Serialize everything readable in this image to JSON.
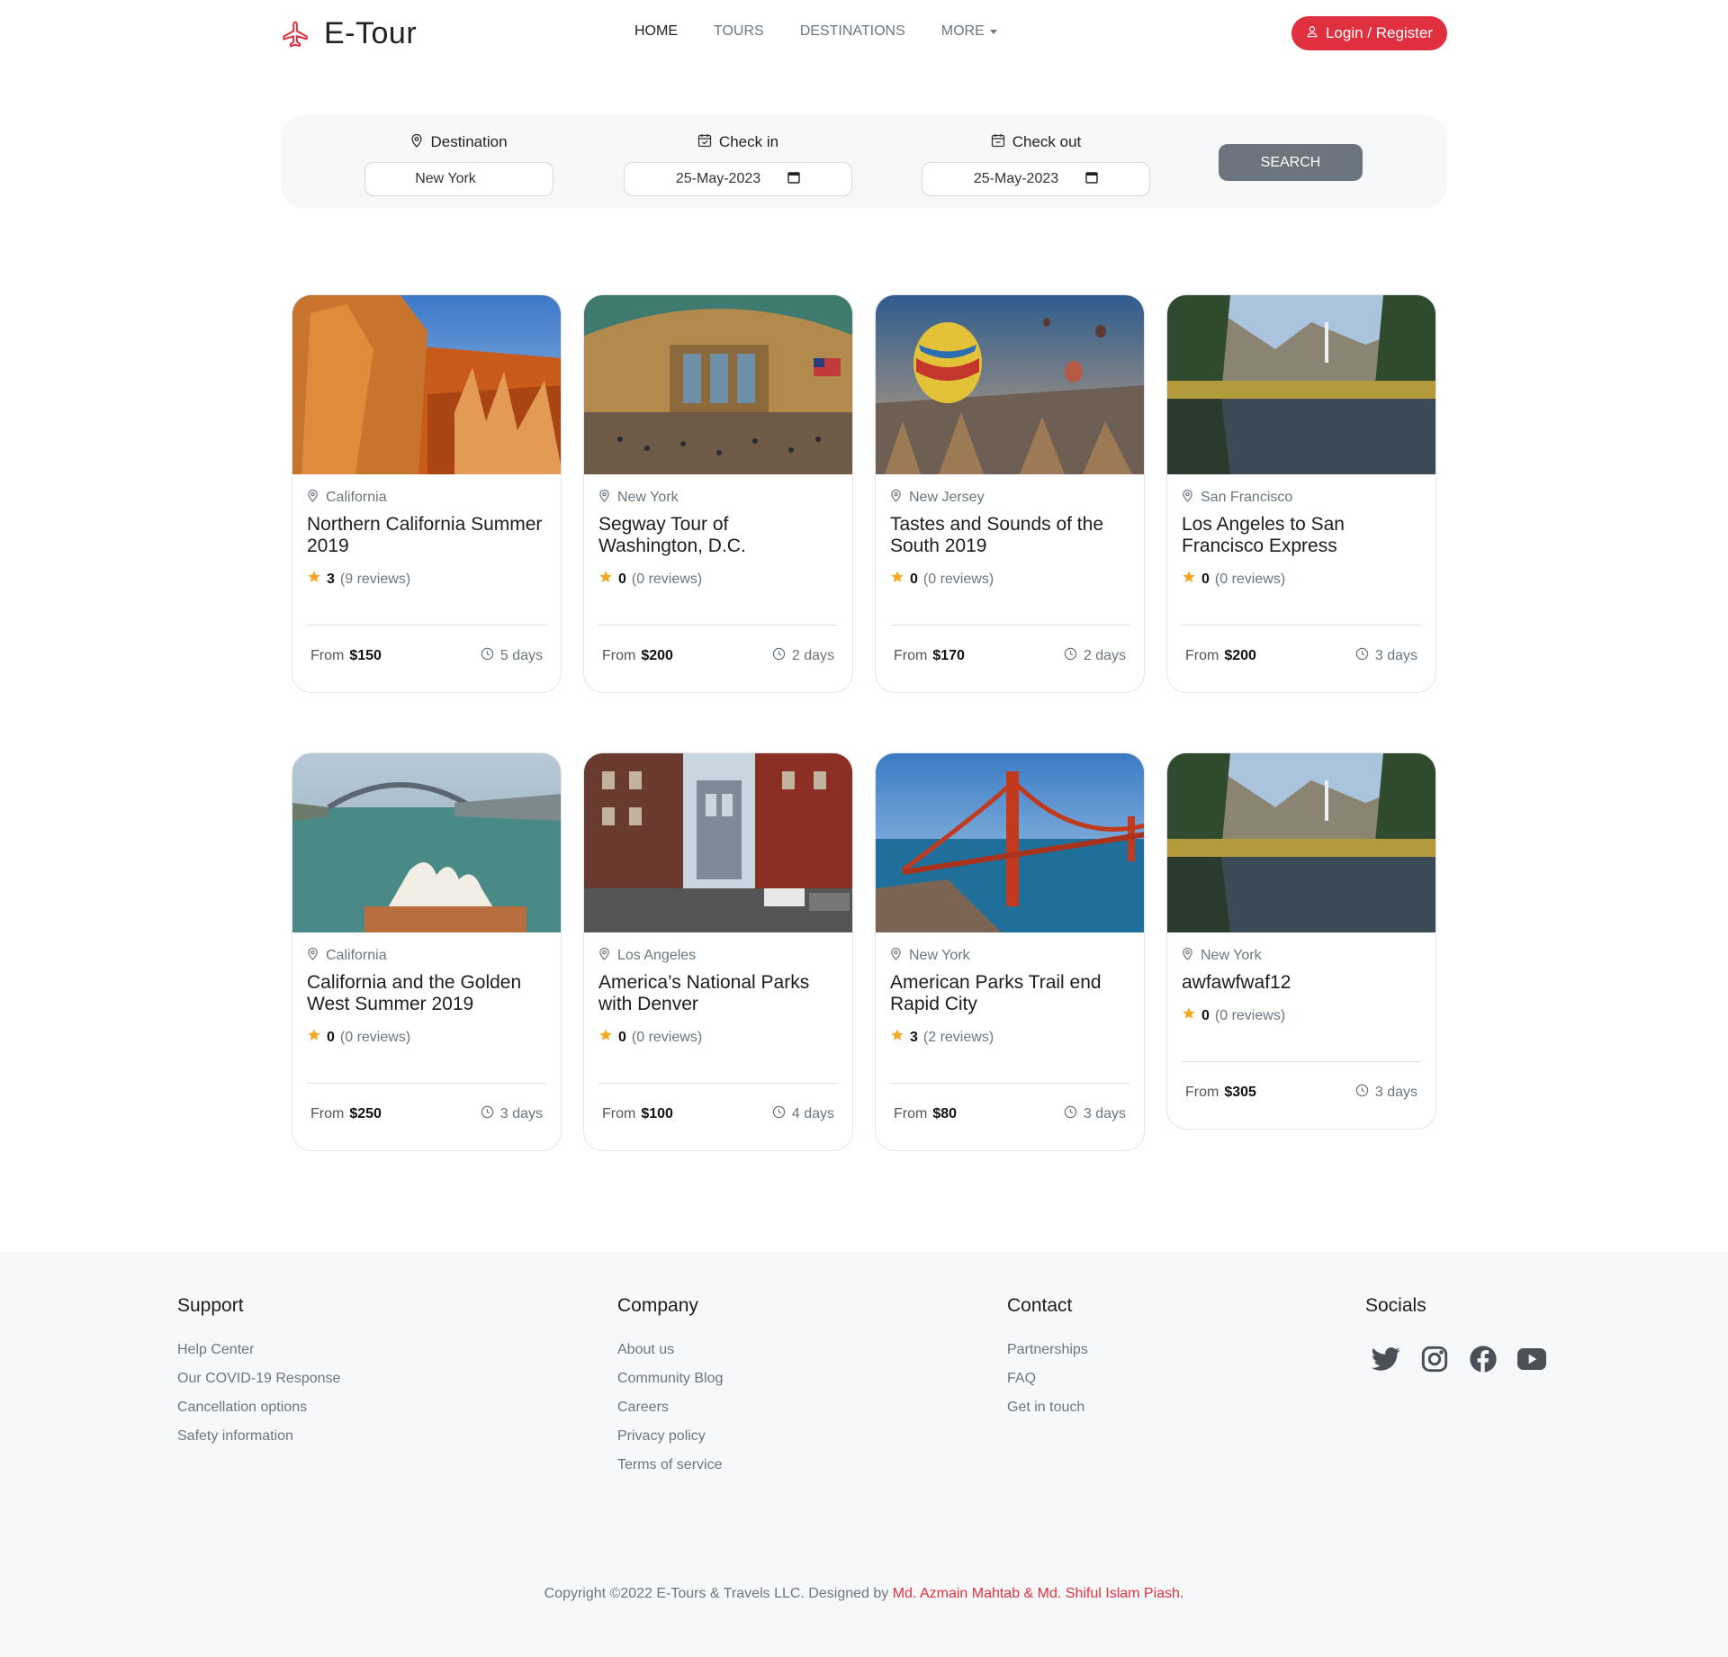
{
  "brand": {
    "name": "E-Tour",
    "accent": "#e0303f",
    "icon": "airplane-icon"
  },
  "nav": {
    "items": [
      "HOME",
      "TOURS",
      "DESTINATIONS"
    ],
    "more": "MORE",
    "login": "Login / Register"
  },
  "search": {
    "destination_label": "Destination",
    "destination_value": "New York",
    "checkin_label": "Check in",
    "checkin_value": "25-May-2023",
    "checkout_label": "Check out",
    "checkout_value": "25-May-2023",
    "button": "SEARCH"
  },
  "tours": [
    {
      "location": "California",
      "title": "Northern California Summer 2019",
      "rating": "3",
      "reviews": "(9 reviews)",
      "price_label": "From",
      "price": "$150",
      "days": "5 days"
    },
    {
      "location": "New York",
      "title": "Segway Tour of Washington, D.C.",
      "rating": "0",
      "reviews": "(0 reviews)",
      "price_label": "From",
      "price": "$200",
      "days": "2 days"
    },
    {
      "location": "New Jersey",
      "title": "Tastes and Sounds of the South 2019",
      "rating": "0",
      "reviews": "(0 reviews)",
      "price_label": "From",
      "price": "$170",
      "days": "2 days"
    },
    {
      "location": "San Francisco",
      "title": "Los Angeles to San Francisco Express",
      "rating": "0",
      "reviews": "(0 reviews)",
      "price_label": "From",
      "price": "$200",
      "days": "3 days"
    },
    {
      "location": "California",
      "title": "California and the Golden West Summer 2019",
      "rating": "0",
      "reviews": "(0 reviews)",
      "price_label": "From",
      "price": "$250",
      "days": "3 days"
    },
    {
      "location": "Los Angeles",
      "title": "America’s National Parks with Denver",
      "rating": "0",
      "reviews": "(0 reviews)",
      "price_label": "From",
      "price": "$100",
      "days": "4 days"
    },
    {
      "location": "New York",
      "title": "American Parks Trail end Rapid City",
      "rating": "3",
      "reviews": "(2 reviews)",
      "price_label": "From",
      "price": "$80",
      "days": "3 days"
    },
    {
      "location": "New York",
      "title": "awfawfwaf12",
      "rating": "0",
      "reviews": "(0 reviews)",
      "price_label": "From",
      "price": "$305",
      "days": "3 days"
    }
  ],
  "footer": {
    "support": {
      "title": "Support",
      "links": [
        "Help Center",
        "Our COVID-19 Response",
        "Cancellation options",
        "Safety information"
      ]
    },
    "company": {
      "title": "Company",
      "links": [
        "About us",
        "Community Blog",
        "Careers",
        "Privacy policy",
        "Terms of service"
      ]
    },
    "contact": {
      "title": "Contact",
      "links": [
        "Partnerships",
        "FAQ",
        "Get in touch"
      ]
    },
    "socials": {
      "title": "Socials",
      "icons": [
        "twitter-icon",
        "instagram-icon",
        "facebook-icon",
        "youtube-icon"
      ]
    },
    "copyright": "Copyright ©2022 E-Tours & Travels LLC. Designed by",
    "authors": "Md. Azmain Mahtab & Md. Shiful Islam Piash."
  }
}
